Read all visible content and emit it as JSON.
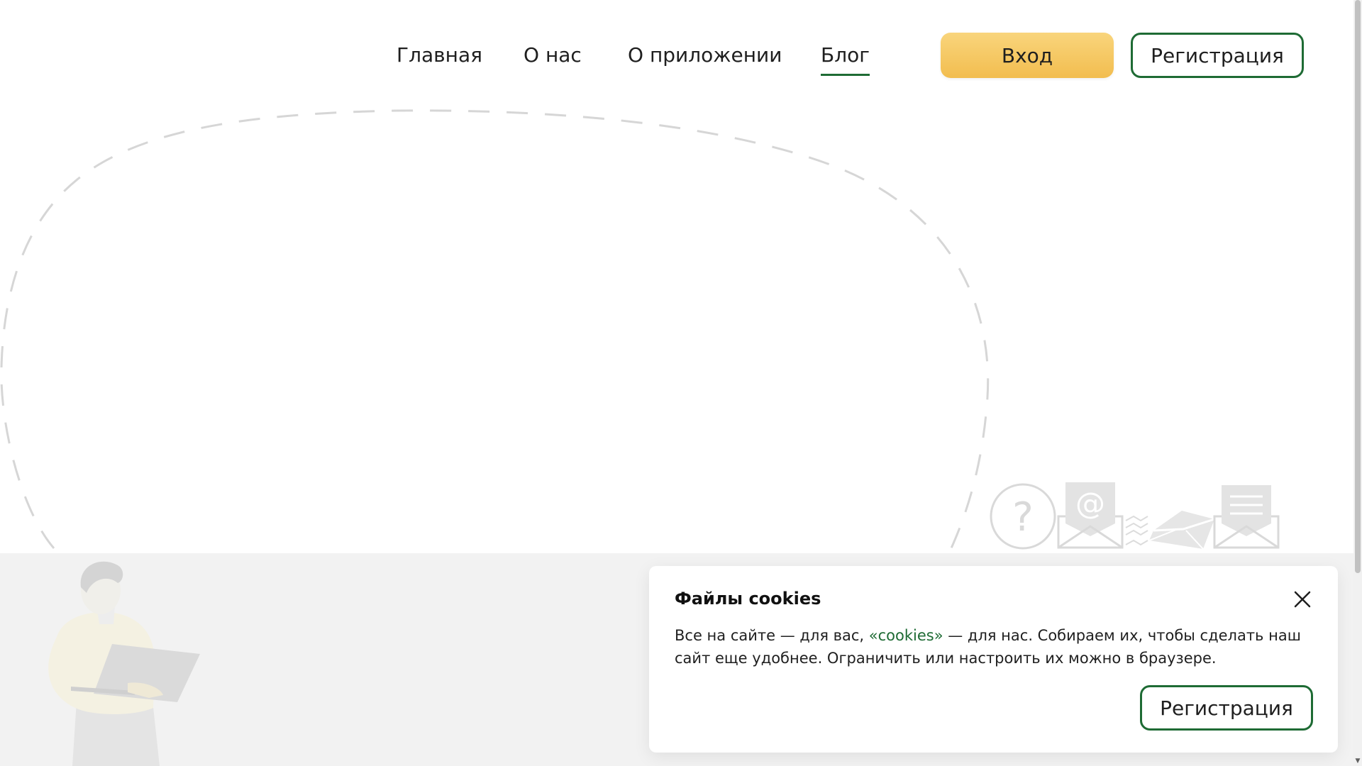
{
  "header": {
    "nav": [
      {
        "label": "Главная",
        "active": false
      },
      {
        "label": "О нас",
        "active": false
      },
      {
        "label": "О приложении",
        "active": false
      },
      {
        "label": "Блог",
        "active": true
      }
    ],
    "login_label": "Вход",
    "register_label": "Регистрация"
  },
  "illustration": {
    "icons": [
      "question-icon",
      "email-at-icon",
      "envelope-icon",
      "letter-icon"
    ],
    "question_mark": "?",
    "at_sign": "@"
  },
  "cookie_banner": {
    "title": "Файлы cookies",
    "text_before_link": "Все на сайте — для вас, ",
    "link_text": "«cookies»",
    "text_after_link": " — для нас. Собираем их, чтобы сделать наш сайт еще удобнее. Ограничить или настроить их можно в браузере.",
    "button_label": "Регистрация",
    "close_icon": "close-icon"
  },
  "colors": {
    "accent_green": "#1e6b34",
    "login_yellow": "#f6c862",
    "gray_band": "#f2f2f2",
    "dashed_line": "#d6d6d6"
  }
}
